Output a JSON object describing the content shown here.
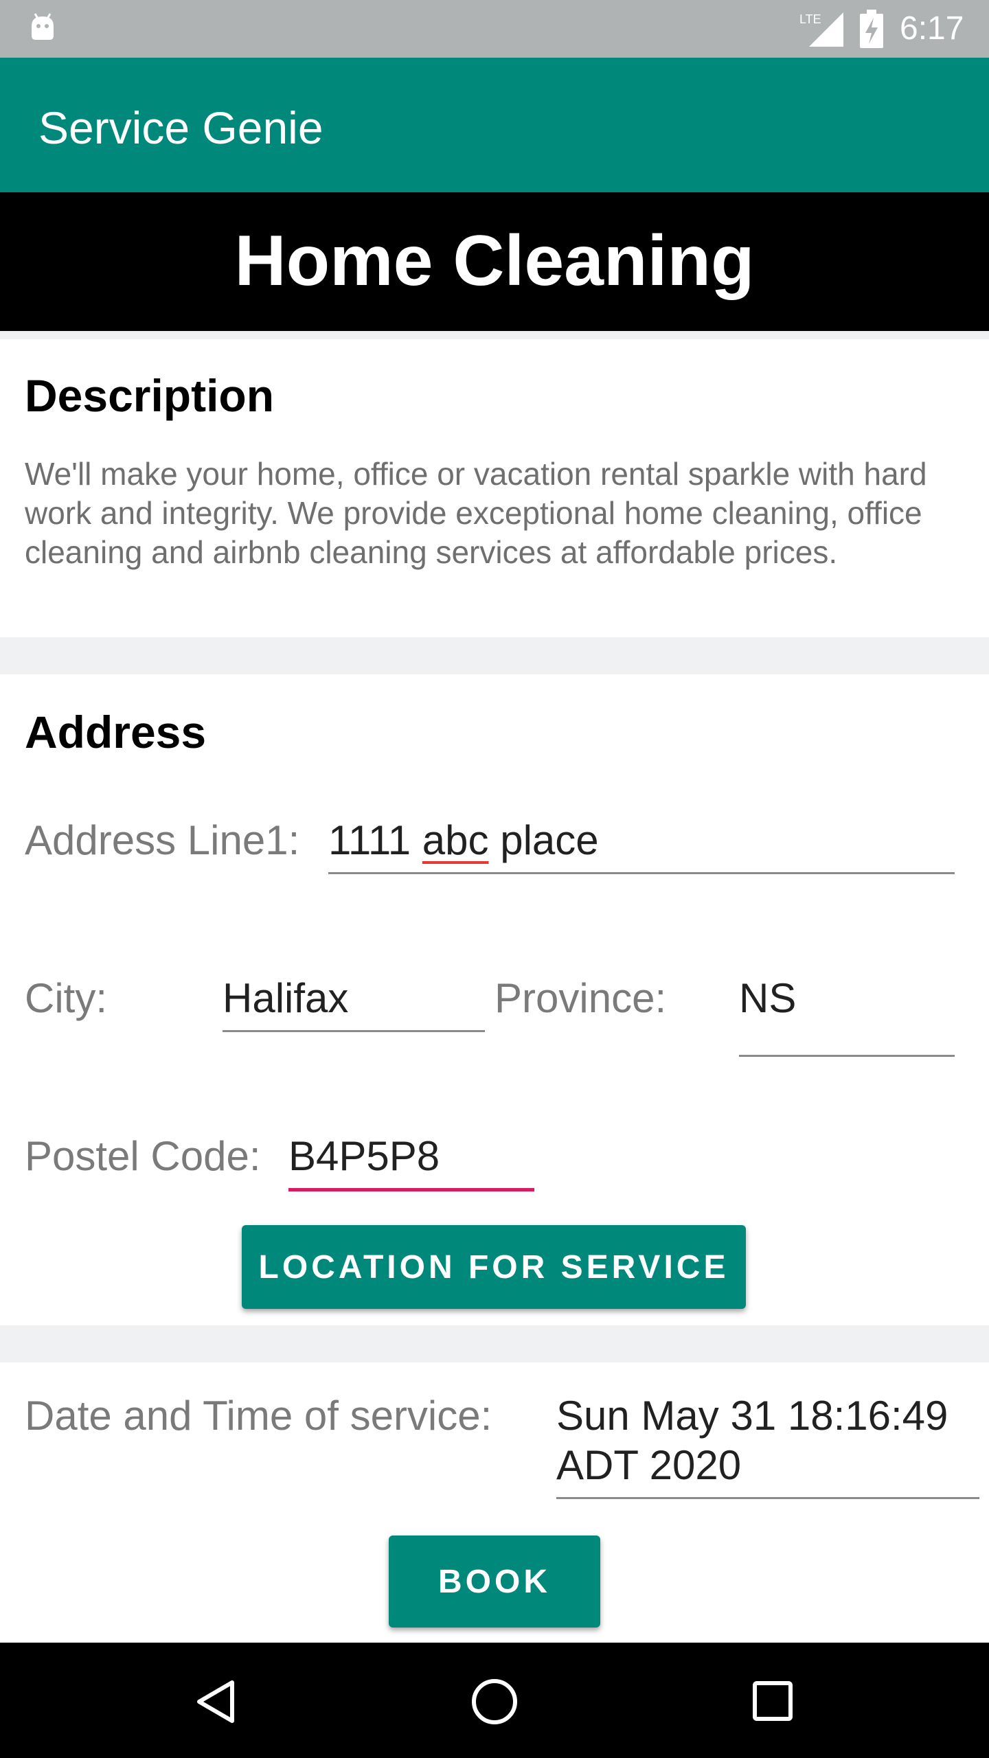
{
  "status_bar": {
    "time": "6:17",
    "network_label": "LTE",
    "icons": [
      "android-icon",
      "lte-signal-icon",
      "battery-charging-icon"
    ]
  },
  "app_bar": {
    "title": "Service Genie"
  },
  "banner": {
    "title": "Home Cleaning"
  },
  "description": {
    "heading": "Description",
    "text": "We'll make your home, office or vacation rental sparkle with hard work and integrity. We provide exceptional home cleaning, office cleaning and airbnb cleaning services at affordable prices."
  },
  "address": {
    "heading": "Address",
    "line1_label": "Address Line1:",
    "line1_value_a": "1111 ",
    "line1_value_b": "abc",
    "line1_value_c": " place",
    "city_label": "City:",
    "city_value": "Halifax",
    "province_label": "Province:",
    "province_value": "NS",
    "postal_label": "Postel Code:",
    "postal_value": "B4P5P8",
    "location_button": "LOCATION FOR SERVICE"
  },
  "schedule": {
    "label": "Date and Time of service:",
    "value_line1": "Sun May 31 18:16:49",
    "value_line2": "ADT 2020",
    "book_button": "BOOK"
  },
  "nav_bar": {
    "icons": [
      "back-icon",
      "home-icon",
      "recents-icon"
    ]
  },
  "colors": {
    "primary": "#00897b",
    "accent": "#d81b60",
    "status_bar": "#b0b3b4"
  }
}
